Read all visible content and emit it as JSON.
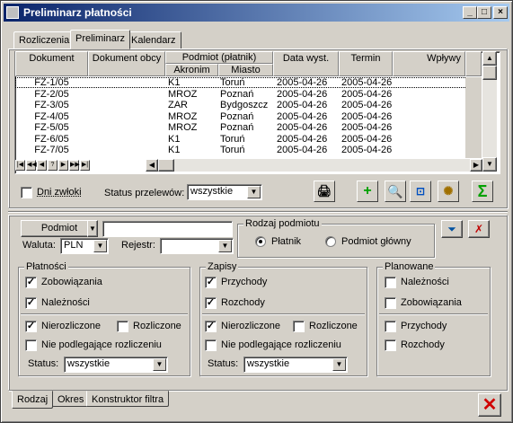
{
  "window": {
    "title": "Preliminarz płatności"
  },
  "top_tabs": [
    "Rozliczenia",
    "Preliminarz",
    "Kalendarz"
  ],
  "grid": {
    "columns": {
      "dokument": "Dokument",
      "dokument_obcy": "Dokument obcy",
      "podmiot": "Podmiot (płatnik)",
      "akronim": "Akronim",
      "miasto": "Miasto",
      "data_wyst": "Data wyst.",
      "termin": "Termin",
      "wplywy": "Wpływy"
    },
    "rows": [
      {
        "dok": "FZ-1/05",
        "obcy": "",
        "akr": "K1",
        "miasto": "Toruń",
        "data": "2005-04-26",
        "termin": "2005-04-26"
      },
      {
        "dok": "FZ-2/05",
        "obcy": "",
        "akr": "MROZ",
        "miasto": "Poznań",
        "data": "2005-04-26",
        "termin": "2005-04-26"
      },
      {
        "dok": "FZ-3/05",
        "obcy": "",
        "akr": "ZAR",
        "miasto": "Bydgoszcz",
        "data": "2005-04-26",
        "termin": "2005-04-26"
      },
      {
        "dok": "FZ-4/05",
        "obcy": "",
        "akr": "MROZ",
        "miasto": "Poznań",
        "data": "2005-04-26",
        "termin": "2005-04-26"
      },
      {
        "dok": "FZ-5/05",
        "obcy": "",
        "akr": "MROZ",
        "miasto": "Poznań",
        "data": "2005-04-26",
        "termin": "2005-04-26"
      },
      {
        "dok": "FZ-6/05",
        "obcy": "",
        "akr": "K1",
        "miasto": "Toruń",
        "data": "2005-04-26",
        "termin": "2005-04-26"
      },
      {
        "dok": "FZ-7/05",
        "obcy": "",
        "akr": "K1",
        "miasto": "Toruń",
        "data": "2005-04-26",
        "termin": "2005-04-26"
      }
    ],
    "nav_buttons": [
      "|◀",
      "◀◀",
      "◀",
      "?",
      "▶",
      "▶▶",
      "▶|"
    ]
  },
  "toolbar": {
    "dni_zwloki": "Dni zwłoki",
    "status_przelewow_label": "Status przelewów:",
    "status_przelewow_value": "wszystkie"
  },
  "filter": {
    "podmiot_button": "Podmiot",
    "podmiot_value": "",
    "waluta_label": "Waluta:",
    "waluta_value": "PLN",
    "rejestr_label": "Rejestr:",
    "rejestr_value": "",
    "rodzaj_podmiotu": {
      "caption": "Rodzaj podmiotu",
      "platnik": "Płatnik",
      "podmiot_glowny": "Podmiot główny"
    },
    "platnosci": {
      "caption": "Płatności",
      "zobowiazania": "Zobowiązania",
      "naleznosci": "Należności",
      "nierozliczone": "Nierozliczone",
      "rozliczone": "Rozliczone",
      "nie_podlegajace": "Nie podlegające rozliczeniu",
      "status_label": "Status:",
      "status_value": "wszystkie"
    },
    "zapisy": {
      "caption": "Zapisy",
      "przychody": "Przychody",
      "rozchody": "Rozchody",
      "nierozliczone": "Nierozliczone",
      "rozliczone": "Rozliczone",
      "nie_podlegajace": "Nie podlegające rozliczeniu",
      "status_label": "Status:",
      "status_value": "wszystkie"
    },
    "planowane": {
      "caption": "Planowane",
      "naleznosci": "Należności",
      "zobowiazania": "Zobowiązania",
      "przychody": "Przychody",
      "rozchody": "Rozchody"
    }
  },
  "bottom_tabs": [
    "Rodzaj",
    "Okres",
    "Konstruktor filtra"
  ],
  "colors": {
    "title_start": "#0a246a",
    "title_end": "#a6caf0",
    "green": "#00a000",
    "red": "#d00000"
  }
}
